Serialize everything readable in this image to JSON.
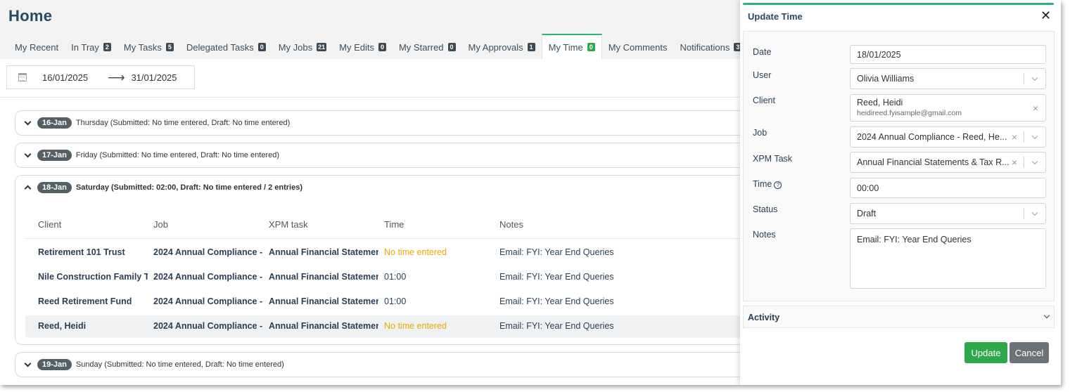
{
  "page": {
    "title": "Home"
  },
  "tabs": [
    {
      "label": "My Recent",
      "badge": ""
    },
    {
      "label": "In Tray",
      "badge": "2"
    },
    {
      "label": "My Tasks",
      "badge": "5"
    },
    {
      "label": "Delegated Tasks",
      "badge": "0"
    },
    {
      "label": "My Jobs",
      "badge": "21"
    },
    {
      "label": "My Edits",
      "badge": "0"
    },
    {
      "label": "My Starred",
      "badge": "0"
    },
    {
      "label": "My Approvals",
      "badge": "1"
    },
    {
      "label": "My Time",
      "badge": "0",
      "active": true
    },
    {
      "label": "My Comments",
      "badge": ""
    },
    {
      "label": "Notifications",
      "badge": "3"
    }
  ],
  "date_range": {
    "from": "16/01/2025",
    "to": "31/01/2025",
    "arrow": "⟶"
  },
  "days": [
    {
      "pill": "16-Jan",
      "summary": "Thursday (Submitted: No time entered, Draft: No time entered)"
    },
    {
      "pill": "17-Jan",
      "summary": "Friday (Submitted: No time entered, Draft: No time entered)"
    },
    {
      "pill": "18-Jan",
      "summary": "Saturday (Submitted: 02:00, Draft: No time entered / 2 entries)"
    },
    {
      "pill": "19-Jan",
      "summary": "Sunday (Submitted: No time entered, Draft: No time entered)"
    }
  ],
  "table": {
    "headers": {
      "client": "Client",
      "job": "Job",
      "task": "XPM task",
      "time": "Time",
      "notes": "Notes"
    },
    "rows": [
      {
        "client": "Retirement 101 Trust",
        "job": "2024 Annual Compliance -...",
        "task": "Annual Financial Statemen...",
        "time": "No time entered",
        "notes": "Email: FYI: Year End Queries"
      },
      {
        "client": "Nile Construction Family T...",
        "job": "2024 Annual Compliance -...",
        "task": "Annual Financial Statemen...",
        "time": "01:00",
        "notes": "Email: FYI: Year End Queries"
      },
      {
        "client": "Reed Retirement Fund",
        "job": "2024 Annual Compliance -...",
        "task": "Annual Financial Statemen...",
        "time": "01:00",
        "notes": "Email: FYI: Year End Queries"
      },
      {
        "client": "Reed, Heidi",
        "job": "2024 Annual Compliance -...",
        "task": "Annual Financial Statemen...",
        "time": "No time entered",
        "notes": "Email: FYI: Year End Queries"
      }
    ]
  },
  "panel": {
    "title": "Update Time",
    "close_glyph": "✕",
    "labels": {
      "date": "Date",
      "user": "User",
      "client": "Client",
      "job": "Job",
      "task": "XPM Task",
      "time": "Time",
      "status": "Status",
      "notes": "Notes"
    },
    "values": {
      "date": "18/01/2025",
      "user": "Olivia Williams",
      "client_name": "Reed, Heidi",
      "client_email": "heidireed.fyisample@gmail.com",
      "job": "2024 Annual Compliance - Reed, He...",
      "task": "Annual Financial Statements & Tax R...",
      "time": "00:00",
      "status": "Draft",
      "notes": "Email: FYI: Year End Queries"
    },
    "help_glyph": "?",
    "clear_glyph": "×",
    "activity": "Activity",
    "update": "Update",
    "cancel": "Cancel"
  },
  "colors": {
    "accent": "#2bb673",
    "update_button": "#2ea84a",
    "cancel_button": "#6c7378",
    "no_time": "#f0a500",
    "title": "#264a64"
  },
  "icons": {
    "date_range": "calendar-icon",
    "range_arrow": "arrow-right-icon",
    "day_toggle": "chevron-icon",
    "close": "close-icon"
  }
}
